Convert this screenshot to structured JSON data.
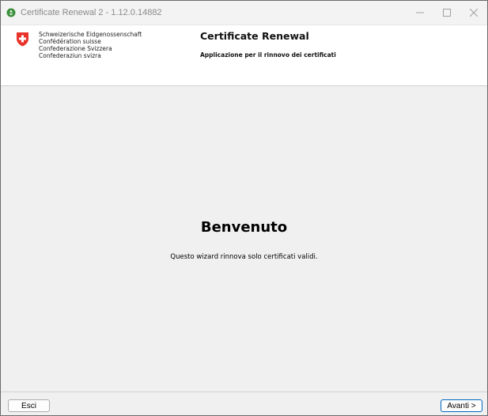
{
  "window": {
    "title": "Certificate Renewal 2 - 1.12.0.14882",
    "icon": "recycle-icon",
    "controls": [
      "minimize-icon",
      "maximize-icon",
      "close-icon"
    ]
  },
  "header": {
    "confederation_lines": [
      "Schweizerische Eidgenossenschaft",
      "Confédération suisse",
      "Confederazione Svizzera",
      "Confederaziun svizra"
    ],
    "app_title": "Certificate Renewal",
    "app_subtitle": "Applicazione per il rinnovo dei certificati",
    "crest_color": "#e8322a"
  },
  "main": {
    "title": "Benvenuto",
    "text": "Questo wizard rinnova solo certificati validi."
  },
  "footer": {
    "exit_label": "Esci",
    "next_label": "Avanti >"
  },
  "colors": {
    "primary_border": "#0067c0"
  }
}
